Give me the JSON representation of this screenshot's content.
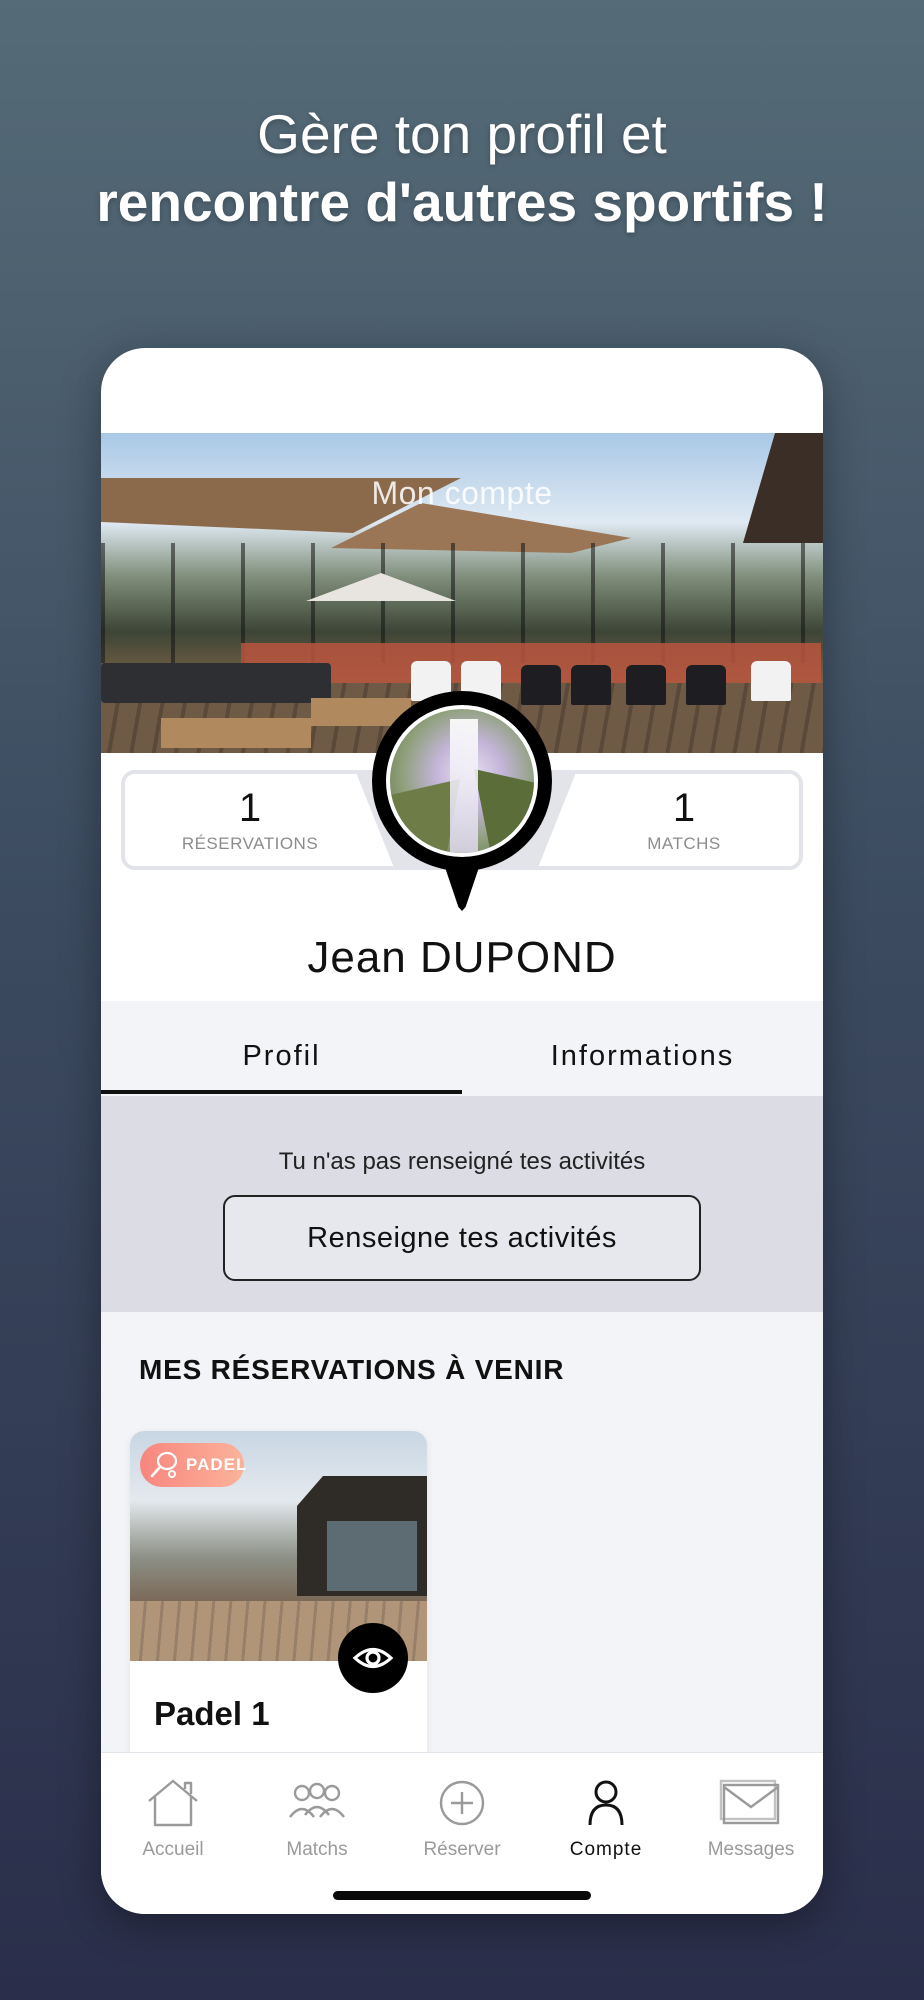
{
  "headline": {
    "line1": "Gère ton profil et",
    "line2": "rencontre d'autres sportifs !"
  },
  "hero": {
    "title": "Mon compte"
  },
  "stats": {
    "reservations": {
      "value": "1",
      "label": "RÉSERVATIONS"
    },
    "matchs": {
      "value": "1",
      "label": "MATCHS"
    }
  },
  "profile": {
    "name": "Jean  DUPOND"
  },
  "tabs": [
    {
      "label": "Profil",
      "active": true
    },
    {
      "label": "Informations",
      "active": false
    }
  ],
  "activities": {
    "message": "Tu n'as pas renseigné tes activités",
    "button_label": "Renseigne tes activités"
  },
  "reservations": {
    "section_title": "MES RÉSERVATIONS À VENIR",
    "items": [
      {
        "sport_badge": "PADEL",
        "name": "Padel 1",
        "badge_icon": "tennis-racket-icon",
        "action_icon": "eye-icon"
      }
    ]
  },
  "navbar": {
    "items": [
      {
        "label": "Accueil",
        "icon": "home-icon",
        "active": false
      },
      {
        "label": "Matchs",
        "icon": "group-icon",
        "active": false
      },
      {
        "label": "Réserver",
        "icon": "plus-circle-icon",
        "active": false
      },
      {
        "label": "Compte",
        "icon": "user-icon",
        "active": true
      },
      {
        "label": "Messages",
        "icon": "mail-icon",
        "active": false
      }
    ]
  },
  "colors": {
    "badge_gradient_start": "#f7867f",
    "badge_gradient_end": "#fbb39a",
    "tab_underline": "#111111",
    "inactive_nav": "#9a9a9a"
  }
}
